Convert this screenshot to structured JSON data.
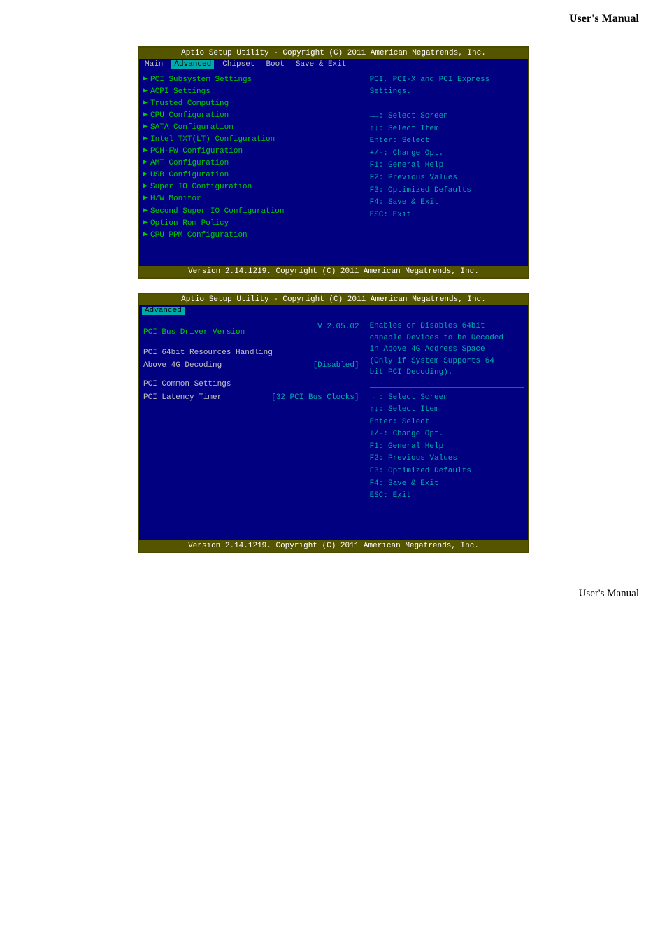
{
  "header": {
    "title": "User's  Manual"
  },
  "footer": {
    "title": "User's  Manual"
  },
  "screenshot1": {
    "title_bar": "Aptio Setup Utility - Copyright (C) 2011 American Megatrends, Inc.",
    "menu_items": [
      "Main",
      "Advanced",
      "Chipset",
      "Boot",
      "Save & Exit"
    ],
    "active_menu": "Advanced",
    "menu_entries": [
      "PCI Subsystem Settings",
      "ACPI Settings",
      "Trusted Computing",
      "CPU Configuration",
      "SATA Configuration",
      "Intel TXT(LT) Configuration",
      "PCH-FW Configuration",
      "AMT Configuration",
      "USB Configuration",
      "Super IO Configuration",
      "H/W Monitor",
      "Second Super IO Configuration",
      "Option Rom Policy",
      "CPU PPM Configuration"
    ],
    "description": "PCI, PCI-X and PCI Express\nSettings.",
    "keys": [
      "→←: Select Screen",
      "↑↓: Select Item",
      "Enter: Select",
      "+/-: Change Opt.",
      "F1: General Help",
      "F2: Previous Values",
      "F3: Optimized Defaults",
      "F4: Save & Exit",
      "ESC: Exit"
    ],
    "footer": "Version 2.14.1219. Copyright (C) 2011 American Megatrends, Inc."
  },
  "screenshot2": {
    "title_bar": "Aptio Setup Utility - Copyright (C) 2011 American Megatrends, Inc.",
    "active_menu": "Advanced",
    "settings": [
      {
        "label": "PCI Bus Driver Version",
        "value": "V 2.05.02",
        "is_header": false
      },
      {
        "label": "PCI 64bit Resources Handling",
        "value": "",
        "is_header": false
      },
      {
        "label": "Above 4G Decoding",
        "value": "[Disabled]",
        "is_header": false
      },
      {
        "label": "PCI Common Settings",
        "value": "",
        "is_header": true
      },
      {
        "label": "PCI Latency Timer",
        "value": "[32 PCI Bus Clocks]",
        "is_header": false
      }
    ],
    "description": "Enables or Disables 64bit\ncapable Devices to be Decoded\nin Above 4G Address Space\n(Only if System Supports 64\nbit PCI Decoding).",
    "keys": [
      "→←: Select Screen",
      "↑↓: Select Item",
      "Enter: Select",
      "+/-: Change Opt.",
      "F1: General Help",
      "F2: Previous Values",
      "F3: Optimized Defaults",
      "F4: Save & Exit",
      "ESC: Exit"
    ],
    "footer": "Version 2.14.1219. Copyright (C) 2011 American Megatrends, Inc."
  }
}
